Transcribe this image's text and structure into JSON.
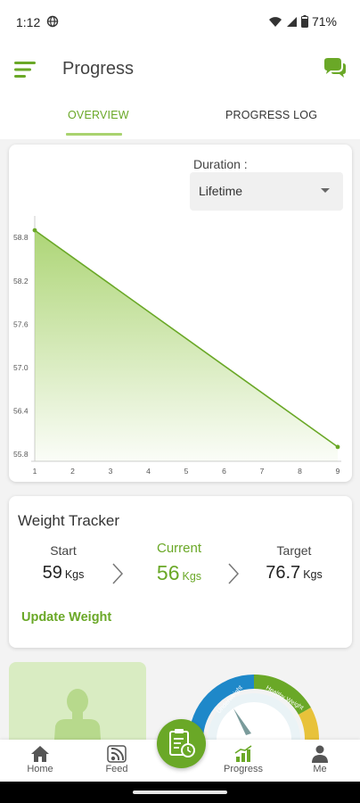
{
  "status_bar": {
    "time": "1:12",
    "battery": "71%"
  },
  "app_bar": {
    "title": "Progress"
  },
  "tabs": [
    {
      "label": "OVERVIEW",
      "active": true
    },
    {
      "label": "PROGRESS LOG",
      "active": false
    }
  ],
  "filter": {
    "label": "Duration :",
    "selected": "Lifetime"
  },
  "chart_data": {
    "type": "area",
    "x": [
      1,
      9
    ],
    "y": [
      58.9,
      55.9
    ],
    "xticks": [
      "1",
      "2",
      "3",
      "4",
      "5",
      "6",
      "7",
      "8",
      "9"
    ],
    "yticks": [
      "55.8",
      "56.4",
      "57.0",
      "57.6",
      "58.2",
      "58.8"
    ],
    "xlim": [
      1,
      9
    ],
    "ylim": [
      55.8,
      59.0
    ],
    "title": "",
    "xlabel": "",
    "ylabel": "",
    "grid": false,
    "line_color": "#6aa827",
    "fill_color": "#a9d36f"
  },
  "tracker": {
    "title": "Weight Tracker",
    "start": {
      "label": "Start",
      "value": "59",
      "unit": "Kgs"
    },
    "current": {
      "label": "Current",
      "value": "56",
      "unit": "Kgs"
    },
    "target": {
      "label": "Target",
      "value": "76.7",
      "unit": "Kgs"
    },
    "update_label": "Update Weight"
  },
  "bmi_gauge": {
    "segments": [
      "Underweight",
      "Healthy Weight"
    ],
    "colors": [
      "#1e88c9",
      "#6aa827",
      "#e8c23a"
    ]
  },
  "nav": [
    {
      "label": "Home",
      "icon": "home-icon"
    },
    {
      "label": "Feed",
      "icon": "feed-icon"
    },
    {
      "label": "Progress",
      "icon": "progress-icon"
    },
    {
      "label": "Me",
      "icon": "person-icon"
    }
  ],
  "colors": {
    "accent": "#6aa827",
    "accent_light": "#a9d36f"
  }
}
